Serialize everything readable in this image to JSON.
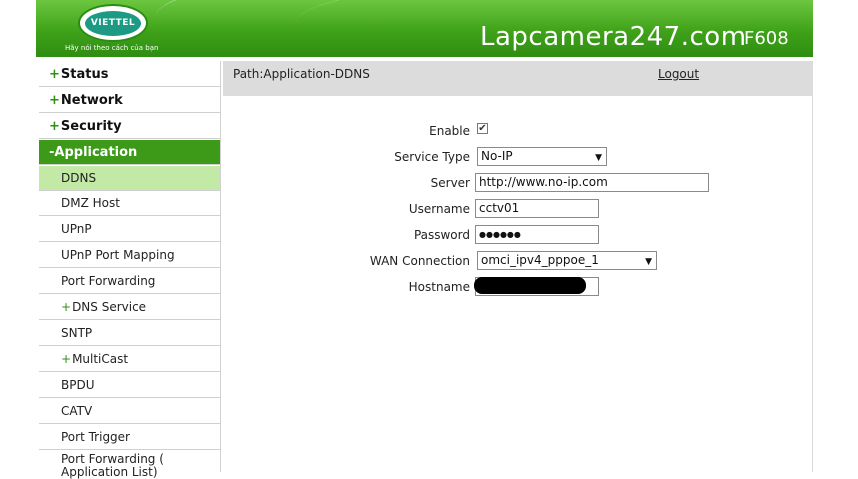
{
  "header": {
    "logo_text": "VIETTEL",
    "slogan": "Hãy nói theo cách của bạn",
    "brand": "Lapcamera247.com",
    "model": "F608"
  },
  "sidebar": {
    "plus": "+",
    "status": "Status",
    "network": "Network",
    "security": "Security",
    "application": "-Application",
    "items": [
      {
        "label": "DDNS"
      },
      {
        "label": "DMZ Host"
      },
      {
        "label": "UPnP"
      },
      {
        "label": "UPnP Port Mapping"
      },
      {
        "label": "Port Forwarding"
      },
      {
        "label": "DNS Service"
      },
      {
        "label": "SNTP"
      },
      {
        "label": "MultiCast"
      },
      {
        "label": "BPDU"
      },
      {
        "label": "CATV"
      },
      {
        "label": "Port Trigger"
      },
      {
        "label": "Port Forwarding ("
      },
      {
        "label": "Application List)"
      }
    ]
  },
  "path": "Path:Application-DDNS",
  "logout": "Logout",
  "form": {
    "enable_label": "Enable",
    "enable_check": "✔",
    "service_type_label": "Service Type",
    "service_type_value": "No-IP",
    "server_label": "Server",
    "server_value": "http://www.no-ip.com",
    "username_label": "Username",
    "username_value": "cctv01",
    "password_label": "Password",
    "password_value": "●●●●●●",
    "wan_label": "WAN Connection",
    "wan_value": "omci_ipv4_pppoe_1",
    "hostname_label": "Hostname",
    "caret": "▼"
  }
}
